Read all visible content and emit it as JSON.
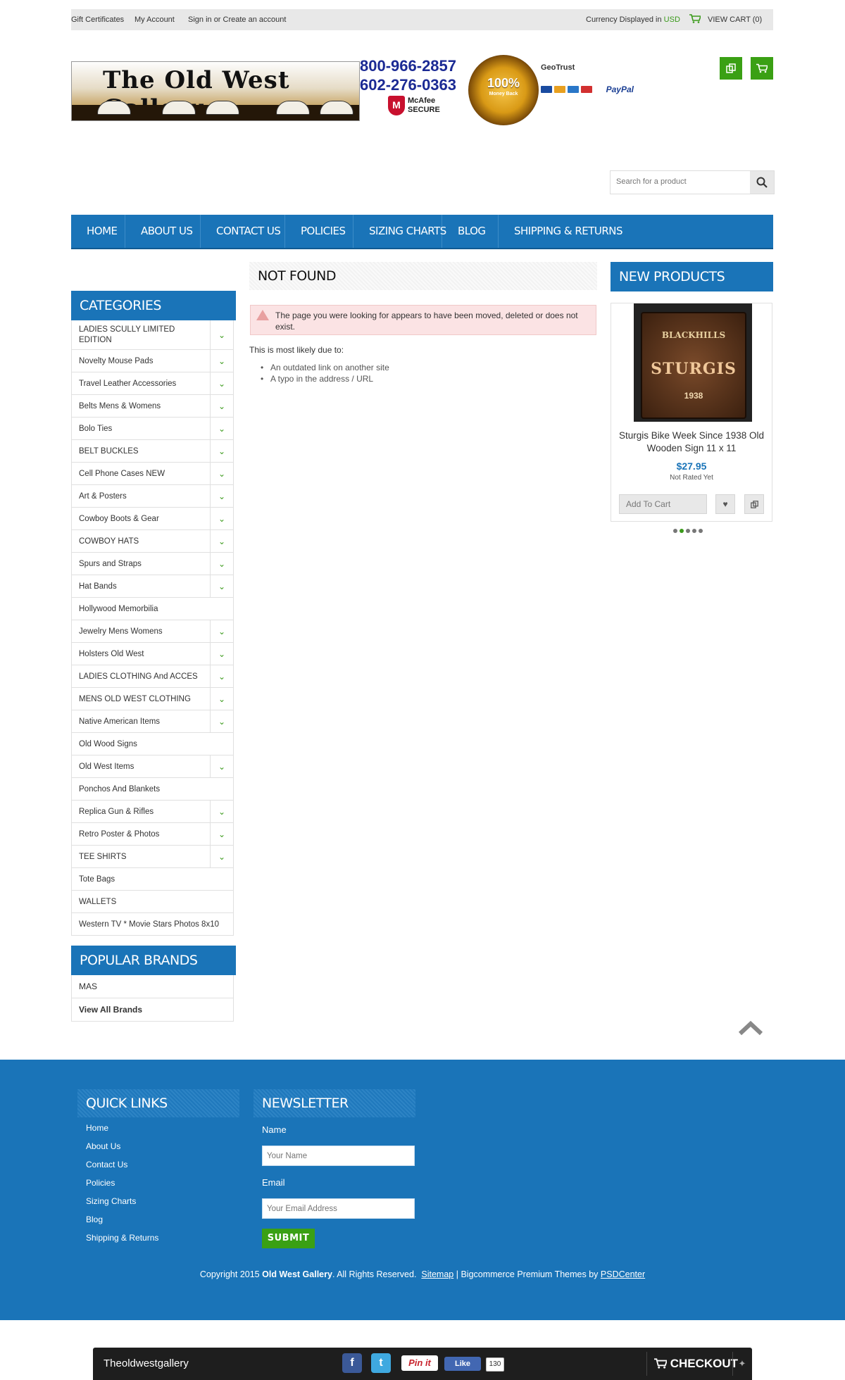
{
  "topbar": {
    "gift_certificates": "Gift Certificates",
    "my_account": "My Account",
    "sign_in": "Sign in or Create an account",
    "currency_label": "Currency Displayed in",
    "currency_value": "USD",
    "view_cart": "VIEW CART (0)"
  },
  "header": {
    "logo_text": "The Old West Gallery",
    "phone1": "800-966-2857",
    "phone2": "602-276-0363",
    "mcafee_line1": "McAfee",
    "mcafee_line2": "SECURE",
    "seal_big": "100%",
    "seal_small": "Money Back",
    "geotrust": "GeoTrust",
    "paypal": "PayPal",
    "compare_icon": "compare-icon",
    "cart_icon": "cart-icon"
  },
  "search": {
    "placeholder": "Search for a product"
  },
  "nav": [
    "HOME",
    "ABOUT US",
    "CONTACT US",
    "POLICIES",
    "SIZING CHARTS",
    "BLOG",
    "SHIPPING & RETURNS"
  ],
  "categories": {
    "title": "CATEGORIES",
    "items": [
      "LADIES SCULLY LIMITED EDITION",
      "Novelty Mouse Pads",
      "Travel Leather Accessories",
      "Belts Mens & Womens",
      "Bolo Ties",
      "BELT BUCKLES",
      "Cell Phone Cases NEW",
      "Art & Posters",
      "Cowboy Boots & Gear",
      "COWBOY HATS",
      "Spurs and Straps",
      "Hat Bands",
      "Hollywood Memorbilia",
      "Jewelry Mens Womens",
      "Holsters Old West",
      "LADIES CLOTHING And ACCES",
      "MENS OLD WEST CLOTHING",
      "Native American Items",
      "Old Wood Signs",
      "Old West Items",
      "Ponchos And Blankets",
      "Replica Gun & Rifles",
      "Retro Poster & Photos",
      "TEE SHIRTS",
      "Tote Bags",
      "WALLETS",
      "Western TV * Movie Stars Photos 8x10"
    ]
  },
  "not_found": {
    "title": "NOT FOUND",
    "alert": "The page you were looking for appears to have been moved, deleted or does not exist.",
    "intro": "This is most likely due to:",
    "reasons": [
      "An outdated link on another site",
      "A typo in the address / URL"
    ]
  },
  "new_products": {
    "title": "NEW PRODUCTS",
    "image_line1": "BLACKHILLS",
    "image_line2": "STURGIS",
    "image_line3": "1938",
    "name": "Sturgis Bike Week Since 1938 Old Wooden Sign 11 x 11",
    "price": "$27.95",
    "rating": "Not Rated Yet",
    "add_to_cart": "Add To Cart"
  },
  "brands": {
    "title": "POPULAR BRANDS",
    "items": [
      "MAS"
    ],
    "view_all": "View All Brands"
  },
  "footer": {
    "quick_links_title": "QUICK LINKS",
    "quick_links": [
      "Home",
      "About Us",
      "Contact Us",
      "Policies",
      "Sizing Charts",
      "Blog",
      "Shipping & Returns"
    ],
    "newsletter_title": "NEWSLETTER",
    "name_label": "Name",
    "name_placeholder": "Your Name",
    "email_label": "Email",
    "email_placeholder": "Your Email Address",
    "submit": "SUBMIT",
    "copyright_pre": "Copyright 2015",
    "copyright_brand": "Old West Gallery",
    "copyright_mid": ". All Rights Reserved.",
    "sitemap": "Sitemap",
    "themes": "| Bigcommerce Premium Themes by",
    "psdcenter": "PSDCenter"
  },
  "bottombar": {
    "site": "Theoldwestgallery",
    "pin": "Pin it",
    "like": "Like",
    "like_count": "130",
    "checkout": "CHECKOUT"
  },
  "colors": {
    "primary_blue": "#1a74b8",
    "accent_green": "#3aa014",
    "alert_bg": "#fbe3e4"
  }
}
